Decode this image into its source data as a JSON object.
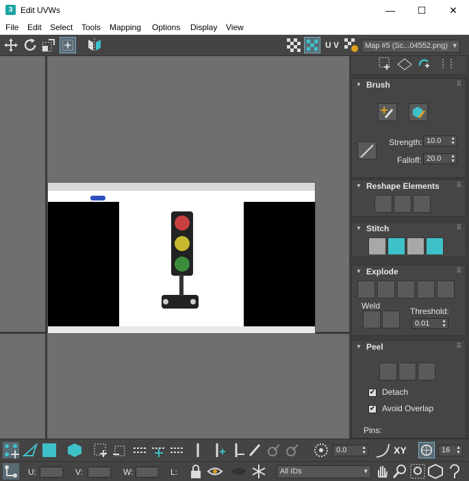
{
  "window": {
    "title": "Edit UVWs",
    "app_icon_text": "3",
    "minimize": "—",
    "maximize": "☐",
    "close": "✕"
  },
  "menu": [
    "File",
    "Edit",
    "Select",
    "Tools",
    "Mapping",
    "Options",
    "Display",
    "View"
  ],
  "toolbar": {
    "uv_label": "U V",
    "map_dropdown": "Map #5 (Sc...04552.png)"
  },
  "brush": {
    "title": "Brush",
    "strength_label": "Strength:",
    "strength_value": "10.0",
    "falloff_label": "Falloff:",
    "falloff_value": "20.0"
  },
  "reshape": {
    "title": "Reshape Elements"
  },
  "stitch": {
    "title": "Stitch"
  },
  "explode": {
    "title": "Explode",
    "weld_label": "Weld",
    "threshold_label": "Threshold:",
    "threshold_value": "0.01"
  },
  "peel": {
    "title": "Peel",
    "detach_label": "Detach",
    "detach_checked": true,
    "avoid_overlap_label": "Avoid Overlap",
    "avoid_overlap_checked": true,
    "pins_label": "Pins:"
  },
  "bottom": {
    "angle_value": "0.0",
    "xy_label": "XY",
    "snap_value": "16",
    "u_label": "U:",
    "v_label": "V:",
    "w_label": "W:",
    "l_label": "L:",
    "ids_select": "All IDs"
  },
  "colors": {
    "accent": "#3fc1c9",
    "bg": "#444444"
  }
}
